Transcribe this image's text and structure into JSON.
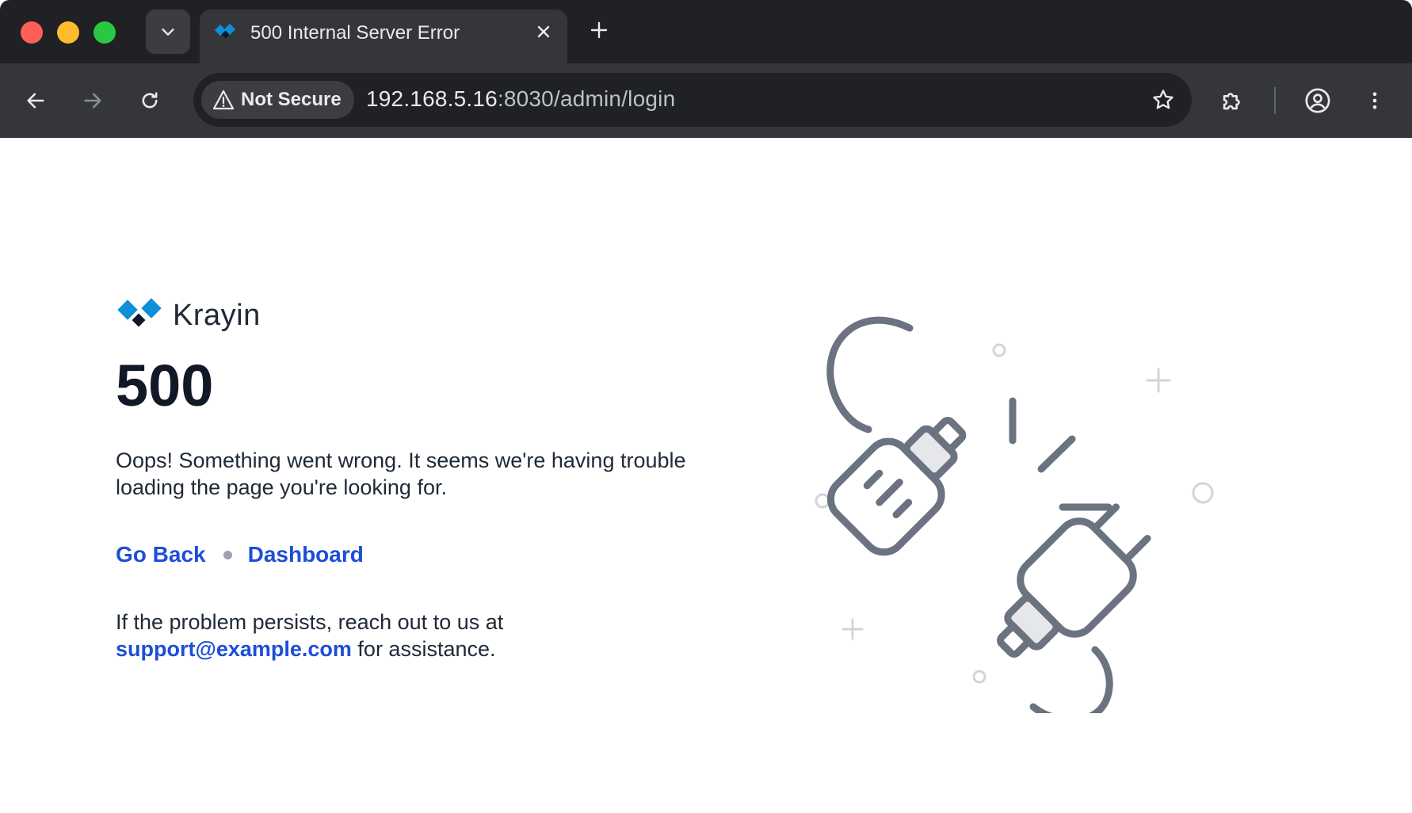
{
  "browser": {
    "tab": {
      "title": "500 Internal Server Error",
      "favicon": "krayin-logo"
    },
    "new_tab_label": "+",
    "address_bar": {
      "security_label": "Not Secure",
      "host": "192.168.5.16",
      "path": ":8030/admin/login"
    },
    "icons": [
      "tab-search-icon",
      "close-icon",
      "new-tab-icon",
      "back-icon",
      "forward-icon",
      "reload-icon",
      "warning-icon",
      "bookmark-star-icon",
      "extensions-icon",
      "profile-icon",
      "more-vert-icon"
    ]
  },
  "page": {
    "brand": {
      "name": "Krayin"
    },
    "error_code": "500",
    "message": "Oops! Something went wrong. It seems we're having trouble loading the page you're looking for.",
    "links": {
      "back": "Go Back",
      "dashboard": "Dashboard"
    },
    "support": {
      "prefix": "If the problem persists, reach out to us at",
      "email": "support@example.com",
      "suffix": "for assistance."
    },
    "illustration": "unplugged-cable"
  },
  "colors": {
    "chrome_dark": "#202124",
    "chrome_toolbar": "#35363a",
    "link_blue": "#1d4ed8",
    "brand_blue": "#0e90d9",
    "text_dark": "#1f2937"
  }
}
